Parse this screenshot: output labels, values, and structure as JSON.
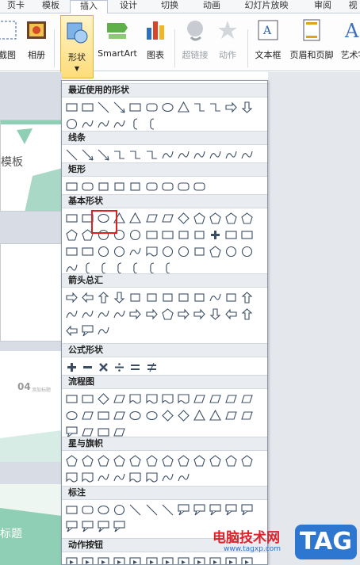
{
  "tabs": [
    "页卡",
    "模板",
    "插入",
    "设计",
    "切换",
    "动画",
    "幻灯片放映",
    "审阅",
    "视"
  ],
  "active_tab": "插入",
  "ribbon": {
    "screenshot_label": "截图",
    "album_label": "相册",
    "shapes_label": "形状",
    "smartart_label": "SmartArt",
    "chart_label": "图表",
    "hyperlink_label": "超链接",
    "action_label": "动作",
    "textbox_label": "文本框",
    "header_footer_label": "页眉和页脚",
    "wordart_label": "艺术字"
  },
  "gallery": {
    "categories": [
      {
        "label": "最近使用的形状",
        "shapes": [
          "textbox",
          "vtextbox",
          "line",
          "arrow",
          "rect",
          "roundrect",
          "oval",
          "triangle",
          "elbow",
          "elbow-arrow",
          "right-arrow",
          "down-arrow",
          "cloud-callout",
          "zigzag",
          "curve",
          "freeform",
          "lbrace",
          "rbrace"
        ]
      },
      {
        "label": "线条",
        "shapes": [
          "line",
          "arrow",
          "double-arrow",
          "elbow",
          "elbow-arrow",
          "elbow-double",
          "curve",
          "curve-arrow",
          "curve-double",
          "freeform",
          "scribble",
          "zigzag"
        ]
      },
      {
        "label": "矩形",
        "shapes": [
          "rect",
          "roundrect",
          "snip1",
          "snip2",
          "snip-diag",
          "snip-round",
          "round1",
          "round2",
          "round-diag"
        ]
      },
      {
        "label": "基本形状",
        "shapes": [
          "textbox",
          "vtextbox",
          "oval",
          "triangle",
          "rtriangle",
          "parallelogram",
          "trapezoid",
          "diamond",
          "pentagon",
          "hexagon",
          "num7",
          "num8",
          "num10",
          "num12",
          "pie",
          "chord",
          "teardrop",
          "frame",
          "halfframe",
          "lshape",
          "diagstripe",
          "cross",
          "plaque",
          "can",
          "cube",
          "bevel",
          "donut",
          "nosymbol",
          "blockarc",
          "foldedcorner",
          "smiley",
          "heart",
          "lightning",
          "sun",
          "moon",
          "cloud",
          "arc",
          "dbracket",
          "dbrace",
          "lbracket",
          "rbracket",
          "lbrace",
          "rbrace"
        ]
      },
      {
        "label": "箭头总汇",
        "shapes": [
          "right-arrow",
          "left-arrow",
          "up-arrow",
          "down-arrow",
          "lr-arrow",
          "ud-arrow",
          "quad-arrow",
          "lru-arrow",
          "bent-arrow",
          "uturn",
          "lu-arrow",
          "bentup",
          "curved-r",
          "curved-l",
          "curved-u",
          "curved-d",
          "striped",
          "notched",
          "pentagon-arrow",
          "chevron",
          "callout-r",
          "callout-d",
          "callout-l",
          "callout-u",
          "callout-lr",
          "callout-quad",
          "circular"
        ]
      },
      {
        "label": "公式形状",
        "shapes": [
          "plus",
          "minus",
          "multiply",
          "divide",
          "equal",
          "notequal"
        ]
      },
      {
        "label": "流程图",
        "shapes": [
          "process",
          "altprocess",
          "decision",
          "data",
          "predefined",
          "internal",
          "document",
          "multidoc",
          "terminator",
          "preparation",
          "manualinput",
          "manualop",
          "connector",
          "offpage",
          "card",
          "punchtape",
          "summing",
          "or",
          "collate",
          "sort",
          "extract",
          "merge",
          "storeddata",
          "delay",
          "seqaccess",
          "magdisk",
          "directaccess",
          "display"
        ]
      },
      {
        "label": "星与旗帜",
        "shapes": [
          "explosion1",
          "explosion2",
          "star4",
          "star5",
          "star6",
          "star7",
          "star8",
          "star10",
          "star12",
          "star16",
          "star24",
          "star32",
          "ribbon-up",
          "ribbon-down",
          "curved-up",
          "curved-down",
          "vscroll",
          "hscroll",
          "wave",
          "dwave"
        ]
      },
      {
        "label": "标注",
        "shapes": [
          "rect-callout",
          "round-callout",
          "oval-callout",
          "cloud-callout",
          "line1",
          "line2",
          "line3",
          "acc1",
          "acc2",
          "acc3",
          "border1",
          "border2",
          "border3",
          "accb1",
          "accb2",
          "accb3"
        ]
      },
      {
        "label": "动作按钮",
        "shapes": [
          "btn-back",
          "btn-fwd",
          "btn-begin",
          "btn-end",
          "btn-home",
          "btn-info",
          "btn-return",
          "btn-movie",
          "btn-doc",
          "btn-sound",
          "btn-help",
          "btn-blank"
        ]
      }
    ]
  },
  "slides": {
    "slide1_text": "模板",
    "slide2_number": "04",
    "slide2_num_text": "添加标题",
    "slide3_text": "标题"
  },
  "watermark": {
    "site_name": "电脑技术网",
    "url": "www.tagxp.com",
    "tag": "TAG"
  }
}
